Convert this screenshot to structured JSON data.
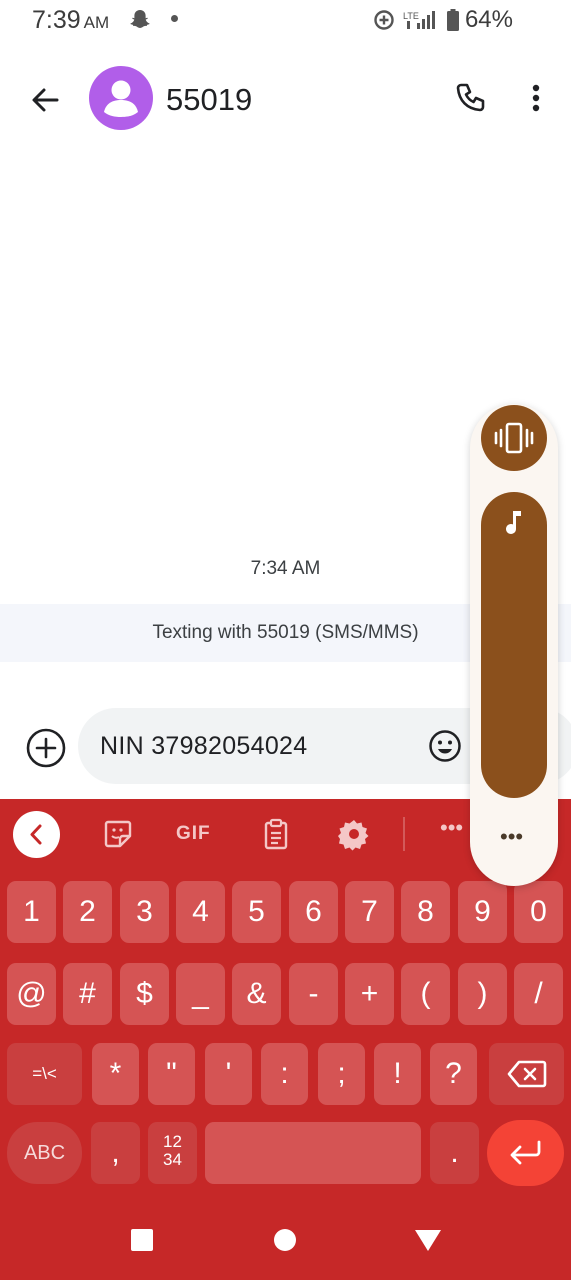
{
  "status_bar": {
    "time": "7:39",
    "ampm": "AM",
    "battery": "64%",
    "network": "LTE"
  },
  "header": {
    "contact_name": "55019"
  },
  "conversation": {
    "timestamp": "7:34 AM",
    "banner": "Texting with 55019 (SMS/MMS)"
  },
  "compose": {
    "text": "NIN 37982054024"
  },
  "keyboard": {
    "toolbar": {
      "gif_label": "GIF",
      "more_label": "•••"
    },
    "row1": [
      "1",
      "2",
      "3",
      "4",
      "5",
      "6",
      "7",
      "8",
      "9",
      "0"
    ],
    "row2": [
      "@",
      "#",
      "$",
      "_",
      "&",
      "-",
      "+",
      "(",
      ")",
      "/"
    ],
    "row3": [
      "=\\<",
      "*",
      "\"",
      "'",
      ":",
      ";",
      "!",
      "?"
    ],
    "row4": {
      "abc": "ABC",
      "comma": ",",
      "numpad_top": "12",
      "numpad_bottom": "34",
      "period": "."
    }
  },
  "volume_panel": {
    "more_label": "•••",
    "accent_color": "#8b501c"
  },
  "colors": {
    "keyboard_bg": "#c62828",
    "key_bg": "#d55454",
    "enter_bg": "#f44336",
    "avatar_bg": "#b15ee9"
  }
}
